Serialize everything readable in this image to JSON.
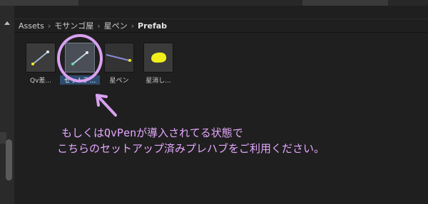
{
  "breadcrumb": {
    "items": [
      "Assets",
      "モサンゴ屋",
      "星ペン",
      "Prefab"
    ]
  },
  "assets": [
    {
      "label": "Qv差..."
    },
    {
      "label": "セットア..."
    },
    {
      "label": "星ペン"
    },
    {
      "label": "星消し..."
    }
  ],
  "annotation": {
    "line1": "もしくはQvPenが導入されてる状態で",
    "line2": "こちらのセットアップ済みプレハブをご利用ください。",
    "color": "#e6a8ff"
  },
  "colors": {
    "background": "#1f1f1f",
    "selection": "#2d4c6e",
    "eraser": "#f2ee1a"
  }
}
